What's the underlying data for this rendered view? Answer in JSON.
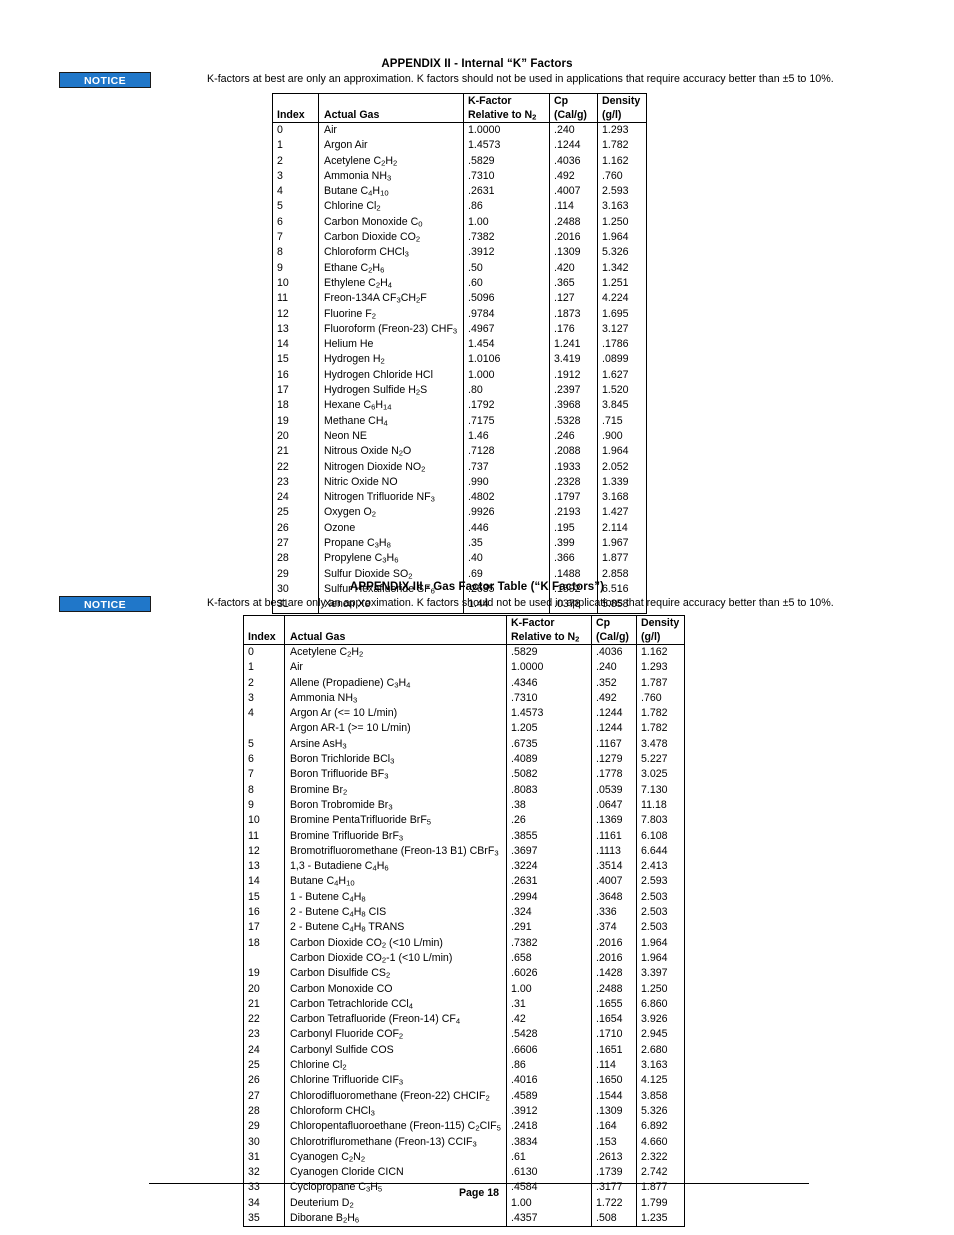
{
  "appendix2": {
    "title": "APPENDIX II - Internal “K” Factors",
    "notice_label": "NOTICE",
    "notice_text": "K-factors at best are only an approximation. K factors should not be used in applications that require accuracy better than ±5 to 10%.",
    "accent_color": "#2077c9",
    "columns": {
      "index": "Index",
      "gas": "Actual Gas",
      "kfactor_line1": "K-Factor",
      "kfactor_line2": "Relative to N",
      "kfactor_sub": "2",
      "cp_line1": "Cp",
      "cp_line2": "(Cal/g)",
      "density_line1": "Density",
      "density_line2": "(g/l)"
    },
    "rows": [
      {
        "index": "0",
        "gas": "Air",
        "formula": "",
        "kf": "1.0000",
        "cp": ".240",
        "density": "1.293"
      },
      {
        "index": "1",
        "gas": "Argon Air",
        "formula": "",
        "kf": "1.4573",
        "cp": ".1244",
        "density": "1.782"
      },
      {
        "index": "2",
        "gas": "Acetylene C",
        "formula": "2|H|2",
        "kf": ".5829",
        "cp": ".4036",
        "density": "1.162"
      },
      {
        "index": "3",
        "gas": "Ammonia NH",
        "formula": "3",
        "kf": ".7310",
        "cp": ".492",
        "density": ".760"
      },
      {
        "index": "4",
        "gas": "Butane C",
        "formula": "4|H|10",
        "kf": ".2631",
        "cp": ".4007",
        "density": "2.593"
      },
      {
        "index": "5",
        "gas": "Chlorine Cl",
        "formula": "2",
        "kf": ".86",
        "cp": ".114",
        "density": "3.163"
      },
      {
        "index": "6",
        "gas": "Carbon Monoxide C",
        "formula": "0",
        "kf": "1.00",
        "cp": ".2488",
        "density": "1.250"
      },
      {
        "index": "7",
        "gas": "Carbon Dioxide CO",
        "formula": "2",
        "kf": ".7382",
        "cp": ".2016",
        "density": "1.964"
      },
      {
        "index": "8",
        "gas": "Chloroform CHCl",
        "formula": "3",
        "kf": ".3912",
        "cp": ".1309",
        "density": "5.326"
      },
      {
        "index": "9",
        "gas": "Ethane C",
        "formula": "2|H|6",
        "kf": ".50",
        "cp": ".420",
        "density": "1.342"
      },
      {
        "index": "10",
        "gas": "Ethylene C",
        "formula": "2|H|4",
        "kf": ".60",
        "cp": ".365",
        "density": "1.251"
      },
      {
        "index": "11",
        "gas": "Freon-134A CF",
        "formula": "3|CH|2|F",
        "kf": ".5096",
        "cp": ".127",
        "density": "4.224"
      },
      {
        "index": "12",
        "gas": "Fluorine F",
        "formula": "2",
        "kf": ".9784",
        "cp": ".1873",
        "density": "1.695"
      },
      {
        "index": "13",
        "gas": "Fluoroform (Freon-23) CHF",
        "formula": "3",
        "kf": ".4967",
        "cp": ".176",
        "density": "3.127"
      },
      {
        "index": "14",
        "gas": "Helium He",
        "formula": "",
        "kf": "1.454",
        "cp": "1.241",
        "density": ".1786"
      },
      {
        "index": "15",
        "gas": "Hydrogen H",
        "formula": "2",
        "kf": "1.0106",
        "cp": "3.419",
        "density": ".0899"
      },
      {
        "index": "16",
        "gas": "Hydrogen Chloride HCl",
        "formula": "",
        "kf": "1.000",
        "cp": ".1912",
        "density": "1.627"
      },
      {
        "index": "17",
        "gas": "Hydrogen Sulfide H",
        "formula": "2|S",
        "kf": ".80",
        "cp": ".2397",
        "density": "1.520"
      },
      {
        "index": "18",
        "gas": "Hexane C",
        "formula": "6|H|14",
        "kf": ".1792",
        "cp": ".3968",
        "density": "3.845"
      },
      {
        "index": "19",
        "gas": "Methane CH",
        "formula": "4",
        "kf": ".7175",
        "cp": ".5328",
        "density": ".715"
      },
      {
        "index": "20",
        "gas": "Neon NE",
        "formula": "",
        "kf": "1.46",
        "cp": ".246",
        "density": ".900"
      },
      {
        "index": "21",
        "gas": "Nitrous Oxide N",
        "formula": "2|O",
        "kf": ".7128",
        "cp": ".2088",
        "density": "1.964"
      },
      {
        "index": "22",
        "gas": "Nitrogen Dioxide NO",
        "formula": "2",
        "kf": ".737",
        "cp": ".1933",
        "density": "2.052"
      },
      {
        "index": "23",
        "gas": "Nitric Oxide NO",
        "formula": "",
        "kf": ".990",
        "cp": ".2328",
        "density": "1.339"
      },
      {
        "index": "24",
        "gas": "Nitrogen Trifluoride NF",
        "formula": "3",
        "kf": ".4802",
        "cp": ".1797",
        "density": "3.168"
      },
      {
        "index": "25",
        "gas": "Oxygen O",
        "formula": "2",
        "kf": ".9926",
        "cp": ".2193",
        "density": "1.427"
      },
      {
        "index": "26",
        "gas": "Ozone",
        "formula": "",
        "kf": ".446",
        "cp": ".195",
        "density": "2.114"
      },
      {
        "index": "27",
        "gas": "Propane C",
        "formula": "3|H|8",
        "kf": ".35",
        "cp": ".399",
        "density": "1.967"
      },
      {
        "index": "28",
        "gas": "Propylene C",
        "formula": "3|H|6",
        "kf": ".40",
        "cp": ".366",
        "density": "1.877"
      },
      {
        "index": "29",
        "gas": "Sulfur Dioxide SO",
        "formula": "2",
        "kf": ".69",
        "cp": ".1488",
        "density": "2.858"
      },
      {
        "index": "30",
        "gas": "Sulfur Hexafluoride SF",
        "formula": "6",
        "kf": ".2635",
        "cp": ".1592",
        "density": "6.516"
      },
      {
        "index": "31",
        "gas": "Xenon Xe",
        "formula": "",
        "kf": "1.44",
        "cp": ".0378",
        "density": "5.858"
      }
    ]
  },
  "appendix3": {
    "title": "APPENDIX III - Gas Factor Table (“K Factors”)",
    "notice_label": "NOTICE",
    "notice_text": "K-factors at best are only an approximation. K factors should not be used in applications that require accuracy better than ±5 to 10%.",
    "accent_color": "#2077c9",
    "columns": {
      "index": "Index",
      "gas": "Actual Gas",
      "kfactor_line1": "K-Factor",
      "kfactor_line2": "Relative to N",
      "kfactor_sub": "2",
      "cp_line1": "Cp",
      "cp_line2": "(Cal/g)",
      "density_line1": "Density",
      "density_line2": "(g/l)"
    },
    "rows": [
      {
        "index": "0",
        "gas": "Acetylene C",
        "formula": "2|H|2",
        "kf": ".5829",
        "cp": ".4036",
        "density": "1.162"
      },
      {
        "index": "1",
        "gas": "Air",
        "formula": "",
        "kf": "1.0000",
        "cp": ".240",
        "density": "1.293"
      },
      {
        "index": "2",
        "gas": "Allene (Propadiene) C",
        "formula": "3|H|4",
        "kf": ".4346",
        "cp": ".352",
        "density": "1.787"
      },
      {
        "index": "3",
        "gas": "Ammonia NH",
        "formula": "3",
        "kf": ".7310",
        "cp": ".492",
        "density": ".760"
      },
      {
        "index": "4",
        "gas": "Argon Ar (<= 10 L/min)",
        "formula": "",
        "kf": "1.4573",
        "cp": ".1244",
        "density": "1.782"
      },
      {
        "index": "",
        "gas": "Argon AR-1 (>= 10 L/min)",
        "formula": "",
        "kf": "1.205",
        "cp": ".1244",
        "density": "1.782"
      },
      {
        "index": "5",
        "gas": "Arsine AsH",
        "formula": "3",
        "kf": ".6735",
        "cp": ".1167",
        "density": "3.478"
      },
      {
        "index": "6",
        "gas": "Boron Trichloride BCl",
        "formula": "3",
        "kf": ".4089",
        "cp": ".1279",
        "density": "5.227"
      },
      {
        "index": "7",
        "gas": "Boron Trifluoride BF",
        "formula": "3",
        "kf": ".5082",
        "cp": ".1778",
        "density": "3.025"
      },
      {
        "index": "8",
        "gas": "Bromine Br",
        "formula": "2",
        "kf": ".8083",
        "cp": ".0539",
        "density": "7.130"
      },
      {
        "index": "9",
        "gas": "Boron Trobromide Br",
        "formula": "3",
        "kf": ".38",
        "cp": ".0647",
        "density": "11.18"
      },
      {
        "index": "10",
        "gas": "Bromine PentaTrifluoride BrF",
        "formula": "5",
        "kf": ".26",
        "cp": ".1369",
        "density": "7.803"
      },
      {
        "index": "11",
        "gas": "Bromine Trifluoride BrF",
        "formula": "3",
        "kf": ".3855",
        "cp": ".1161",
        "density": "6.108"
      },
      {
        "index": "12",
        "gas": "Bromotrifluoromethane (Freon-13 B1) CBrF",
        "formula": "3",
        "kf": ".3697",
        "cp": ".1113",
        "density": "6.644"
      },
      {
        "index": "13",
        "gas": "1,3 - Butadiene C",
        "formula": "4|H|6",
        "kf": ".3224",
        "cp": ".3514",
        "density": "2.413"
      },
      {
        "index": "14",
        "gas": "Butane C",
        "formula": "4|H|10",
        "kf": ".2631",
        "cp": ".4007",
        "density": "2.593"
      },
      {
        "index": "15",
        "gas": "1 - Butene C",
        "formula": "4|H|8",
        "kf": ".2994",
        "cp": ".3648",
        "density": "2.503"
      },
      {
        "index": "16",
        "gas": "2 - Butene C",
        "formula": "4|H|8| CIS",
        "kf": ".324",
        "cp": ".336",
        "density": "2.503"
      },
      {
        "index": "17",
        "gas": "2 - Butene C",
        "formula": "4|H|8| TRANS",
        "kf": ".291",
        "cp": ".374",
        "density": "2.503"
      },
      {
        "index": "18",
        "gas": "Carbon Dioxide CO",
        "formula": "2| (<10 L/min)",
        "kf": ".7382",
        "cp": ".2016",
        "density": "1.964"
      },
      {
        "index": "",
        "gas": "Carbon Dioxide CO",
        "formula": "2|-1 (<10 L/min)",
        "kf": ".658",
        "cp": ".2016",
        "density": "1.964"
      },
      {
        "index": "19",
        "gas": "Carbon Disulfide CS",
        "formula": "2",
        "kf": ".6026",
        "cp": ".1428",
        "density": "3.397"
      },
      {
        "index": "20",
        "gas": "Carbon Monoxide CO",
        "formula": "",
        "kf": "1.00",
        "cp": ".2488",
        "density": "1.250"
      },
      {
        "index": "21",
        "gas": "Carbon Tetrachloride CCl",
        "formula": "4",
        "kf": ".31",
        "cp": ".1655",
        "density": "6.860"
      },
      {
        "index": "22",
        "gas": "Carbon Tetrafluoride (Freon-14) CF",
        "formula": "4",
        "kf": ".42",
        "cp": ".1654",
        "density": "3.926"
      },
      {
        "index": "23",
        "gas": "Carbonyl Fluoride COF",
        "formula": "2",
        "kf": ".5428",
        "cp": ".1710",
        "density": "2.945"
      },
      {
        "index": "24",
        "gas": "Carbonyl Sulfide COS",
        "formula": "",
        "kf": ".6606",
        "cp": ".1651",
        "density": "2.680"
      },
      {
        "index": "25",
        "gas": "Chlorine Cl",
        "formula": "2",
        "kf": ".86",
        "cp": ".114",
        "density": "3.163"
      },
      {
        "index": "26",
        "gas": "Chlorine Trifluoride CIF",
        "formula": "3",
        "kf": ".4016",
        "cp": ".1650",
        "density": "4.125"
      },
      {
        "index": "27",
        "gas": "Chlorodifluoromethane (Freon-22) CHCIF",
        "formula": "2",
        "kf": ".4589",
        "cp": ".1544",
        "density": "3.858"
      },
      {
        "index": "28",
        "gas": "Chloroform CHCl",
        "formula": "3",
        "kf": ".3912",
        "cp": ".1309",
        "density": "5.326"
      },
      {
        "index": "29",
        "gas": "Chloropentafluoroethane (Freon-115) C",
        "formula": "2|CIF|5",
        "kf": ".2418",
        "cp": ".164",
        "density": "6.892"
      },
      {
        "index": "30",
        "gas": "Chlorotrifluromethane (Freon-13) CCIF",
        "formula": "3",
        "kf": ".3834",
        "cp": ".153",
        "density": "4.660"
      },
      {
        "index": "31",
        "gas": "Cyanogen C",
        "formula": "2|N|2",
        "kf": ".61",
        "cp": ".2613",
        "density": "2.322"
      },
      {
        "index": "32",
        "gas": "Cyanogen Cloride CICN",
        "formula": "",
        "kf": ".6130",
        "cp": ".1739",
        "density": "2.742"
      },
      {
        "index": "33",
        "gas": "Cyclopropane C",
        "formula": "3|H|5",
        "kf": ".4584",
        "cp": ".3177",
        "density": "1.877"
      },
      {
        "index": "34",
        "gas": "Deuterium D",
        "formula": "2",
        "kf": "1.00",
        "cp": "1.722",
        "density": "1.799"
      },
      {
        "index": "35",
        "gas": "Diborane B",
        "formula": "2|H|6",
        "kf": ".4357",
        "cp": ".508",
        "density": "1.235"
      }
    ]
  },
  "footer": {
    "page_label": "Page 18"
  }
}
